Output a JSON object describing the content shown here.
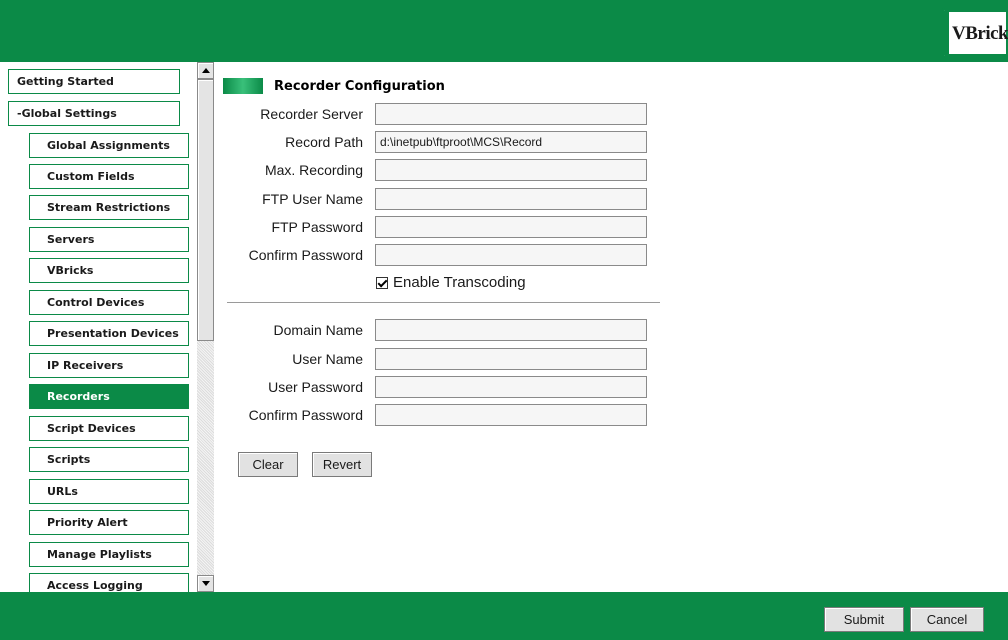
{
  "header": {
    "logo_text": "VBrick"
  },
  "sidebar": {
    "items": [
      {
        "label": "Getting Started"
      },
      {
        "label": "-Global Settings"
      },
      {
        "label": "Global Assignments"
      },
      {
        "label": "Custom Fields"
      },
      {
        "label": "Stream Restrictions"
      },
      {
        "label": "Servers"
      },
      {
        "label": "VBricks"
      },
      {
        "label": "Control Devices"
      },
      {
        "label": "Presentation Devices"
      },
      {
        "label": "IP Receivers"
      },
      {
        "label": "Recorders",
        "active": true
      },
      {
        "label": "Script Devices"
      },
      {
        "label": "Scripts"
      },
      {
        "label": "URLs"
      },
      {
        "label": "Priority Alert"
      },
      {
        "label": "Manage Playlists"
      },
      {
        "label": "Access Logging"
      }
    ]
  },
  "main": {
    "section_title": "Recorder Configuration",
    "fields": {
      "recorder_server": {
        "label": "Recorder Server",
        "value": ""
      },
      "record_path": {
        "label": "Record Path",
        "value": "d:\\inetpub\\ftproot\\MCS\\Record"
      },
      "max_recording": {
        "label": "Max. Recording",
        "value": ""
      },
      "ftp_user_name": {
        "label": "FTP User Name",
        "value": ""
      },
      "ftp_password": {
        "label": "FTP Password",
        "value": ""
      },
      "confirm_password_1": {
        "label": "Confirm Password",
        "value": ""
      },
      "domain_name": {
        "label": "Domain Name",
        "value": ""
      },
      "user_name": {
        "label": "User Name",
        "value": ""
      },
      "user_password": {
        "label": "User Password",
        "value": ""
      },
      "confirm_password_2": {
        "label": "Confirm Password",
        "value": ""
      }
    },
    "enable_transcoding": {
      "label": "Enable Transcoding",
      "checked": true
    },
    "buttons": {
      "clear": "Clear",
      "revert": "Revert"
    }
  },
  "footer": {
    "submit": "Submit",
    "cancel": "Cancel"
  },
  "colors": {
    "brand_green": "#0b8a47"
  }
}
